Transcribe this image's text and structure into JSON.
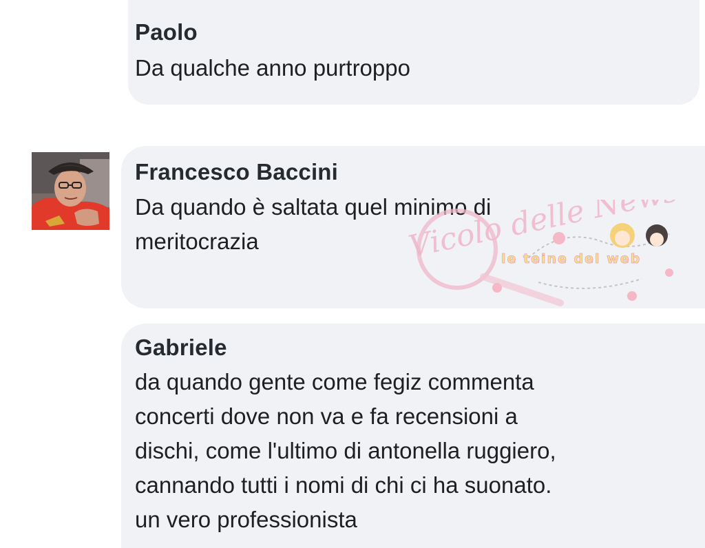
{
  "comments": [
    {
      "author": "Paolo",
      "text": "Da qualche anno purtroppo",
      "has_avatar": false
    },
    {
      "author": "Francesco Baccini",
      "text": "Da quando è saltata quel minimo di\nmeritocrazia",
      "has_avatar": true,
      "avatar_icon": "profile-photo"
    },
    {
      "author": "Gabriele",
      "text": "da quando gente come fegiz commenta\nconcerti dove non va e fa recensioni a\ndischi, come l'ultimo di antonella ruggiero,\ncannando tutti i nomi di chi ci ha suonato.\nun vero professionista",
      "has_avatar": false
    }
  ],
  "watermark": {
    "logo_text": "Vicolo delle News",
    "tagline": "le teine del web",
    "color": "#f0b7c9"
  },
  "colors": {
    "bubble": "#f0f2f5",
    "name": "#262b31",
    "text": "#1d1f22"
  }
}
